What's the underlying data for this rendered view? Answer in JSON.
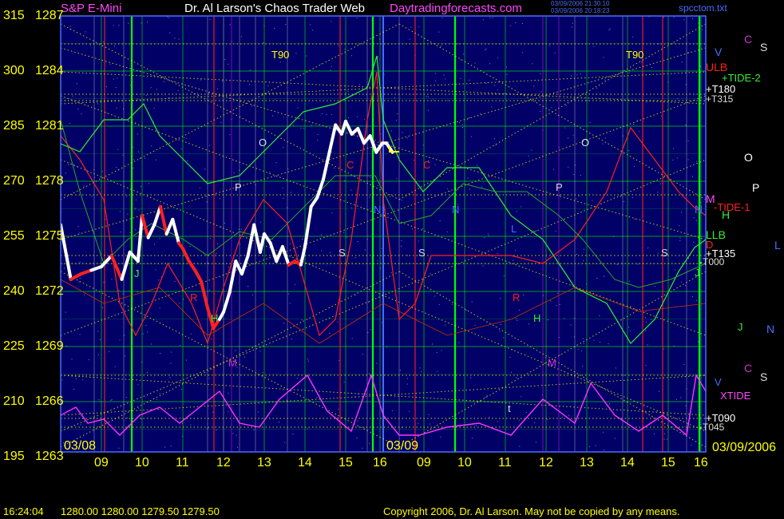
{
  "header": {
    "instrument": "S&P E-Mini",
    "title": "Dr. Al Larson's Chaos Trader Web",
    "site": "Daytradingforecasts.com",
    "stamp_line1": "03/09/2006 21:30:10",
    "stamp_line2": "03/09/2006 20:18:23",
    "file": "spcctom.txt"
  },
  "footer": {
    "time": "16:24:04",
    "quote": "1280.00 1280.00 1279.50 1279.50",
    "copyright": "Copyright 2006, Dr. Al Larson. May not be copied by any means."
  },
  "chart_data": {
    "type": "line",
    "title": "S&P E-Mini",
    "left_axis_labels": [
      "315",
      "300",
      "285",
      "270",
      "255",
      "240",
      "225",
      "210",
      "195"
    ],
    "price_axis_labels": [
      "1287",
      "1284",
      "1281",
      "1278",
      "1275",
      "1272",
      "1269",
      "1266",
      "1263"
    ],
    "price_range": [
      1263,
      1287
    ],
    "x_tick_labels_day1": [
      "09",
      "10",
      "11",
      "12",
      "13",
      "14",
      "15",
      "16"
    ],
    "x_tick_labels_day2": [
      "09",
      "10",
      "11",
      "12",
      "13",
      "14",
      "15",
      "16"
    ],
    "date_labels": [
      "03/08",
      "03/09",
      "03/09/2006"
    ],
    "right_labels": [
      "C",
      "S",
      "V",
      "ULB",
      "+TIDE-2",
      "+T180",
      "+T315",
      "O",
      "P",
      "M",
      "-TIDE-1",
      "N",
      "H",
      "LLB",
      "D",
      "L",
      "+T135",
      "-T000",
      "J",
      "N",
      "J",
      "C",
      "S",
      "V",
      "XTIDE",
      "+T090",
      "-T045"
    ],
    "in_chart_labels": [
      "T90",
      "T90",
      "O",
      "P",
      "N",
      "N",
      "L",
      "C",
      "C",
      "R",
      "R",
      "H",
      "H",
      "M",
      "M",
      "S",
      "S",
      "J",
      "O",
      "P",
      "S",
      "t"
    ],
    "price_series": {
      "name": "S&P E-Mini",
      "x_hours": [
        8.0,
        8.25,
        8.5,
        8.75,
        9.0,
        9.25,
        9.5,
        9.7,
        9.9,
        10.0,
        10.15,
        10.3,
        10.45,
        10.6,
        10.75,
        10.9,
        11.0,
        11.15,
        11.3,
        11.45,
        11.6,
        11.75,
        11.9,
        12.0,
        12.15,
        12.3,
        12.45,
        12.6,
        12.75,
        12.9,
        13.0,
        13.15,
        13.3,
        13.45,
        13.6,
        13.75,
        13.9,
        14.0,
        14.15,
        14.3,
        14.45,
        14.6,
        14.75,
        14.9,
        15.0,
        15.15,
        15.3,
        15.45,
        15.6,
        15.75,
        15.9,
        16.0,
        16.15
      ],
      "values": [
        1275.5,
        1272.5,
        1272.8,
        1273.0,
        1273.2,
        1273.8,
        1272.5,
        1274.0,
        1273.5,
        1276.0,
        1274.8,
        1275.5,
        1276.5,
        1275.0,
        1275.8,
        1274.5,
        1274.2,
        1273.5,
        1273.0,
        1272.4,
        1271.0,
        1269.8,
        1270.3,
        1270.7,
        1271.8,
        1273.5,
        1272.8,
        1273.8,
        1275.5,
        1274.0,
        1275.0,
        1274.5,
        1273.5,
        1274.3,
        1273.3,
        1273.5,
        1273.3,
        1274.3,
        1276.5,
        1277.0,
        1278.0,
        1279.5,
        1281.0,
        1280.5,
        1281.2,
        1280.5,
        1280.8,
        1280.0,
        1280.4,
        1279.5,
        1280.0,
        1280.0,
        1279.5
      ],
      "dir": [
        0,
        0,
        -1,
        -1,
        1,
        1,
        -1,
        1,
        1,
        1,
        -1,
        1,
        1,
        -1,
        1,
        1,
        -1,
        -1,
        -1,
        -1,
        -1,
        -1,
        -1,
        1,
        1,
        1,
        1,
        1,
        1,
        1,
        1,
        1,
        1,
        1,
        1,
        -1,
        -1,
        1,
        1,
        1,
        1,
        1,
        1,
        1,
        1,
        1,
        1,
        1,
        1,
        1,
        1,
        1,
        1
      ]
    },
    "colors": {
      "background": "#000066",
      "grid_green": "#00ff00",
      "grid_yellow": "#ffff00",
      "price_up": "#ffffff",
      "price_down": "#ff2020",
      "forecast_red": "#ff2020",
      "forecast_green": "#33ee33",
      "xtide_magenta": "#ff33ff",
      "header_purple": "#ff44ff",
      "header_text": "#ffffff",
      "blue_text": "#4a6bff"
    }
  }
}
